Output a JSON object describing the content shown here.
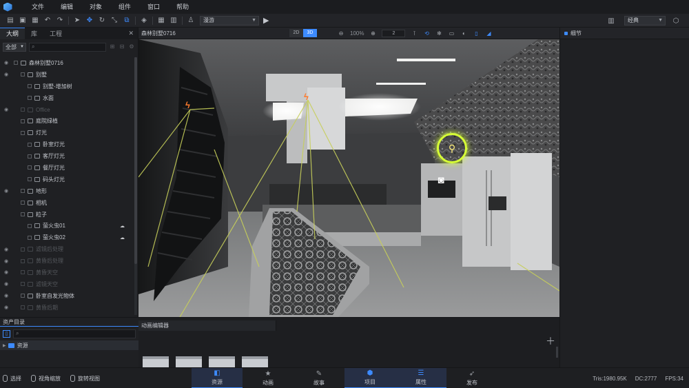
{
  "menu": [
    "文件",
    "编辑",
    "对象",
    "组件",
    "窗口",
    "帮助"
  ],
  "toolbar": {
    "mode_select": "漫游",
    "style_select": "经典"
  },
  "left_panel": {
    "tabs": [
      "大纲",
      "库",
      "工程"
    ],
    "filter_select": "全部",
    "tree": [
      {
        "label": "森林别墅0716",
        "indent": 0,
        "dim": false,
        "eye": true
      },
      {
        "label": "别墅",
        "indent": 1,
        "dim": false,
        "eye": true
      },
      {
        "label": "别墅-增加树",
        "indent": 2,
        "dim": false,
        "eye": false
      },
      {
        "label": "水面",
        "indent": 2,
        "dim": false,
        "eye": false
      },
      {
        "label": "Office",
        "indent": 1,
        "dim": true,
        "eye": true
      },
      {
        "label": "庭院绿植",
        "indent": 1,
        "dim": false,
        "eye": false
      },
      {
        "label": "灯光",
        "indent": 1,
        "dim": false,
        "eye": false
      },
      {
        "label": "卧室灯光",
        "indent": 2,
        "dim": false,
        "eye": false
      },
      {
        "label": "客厅灯光",
        "indent": 2,
        "dim": false,
        "eye": false
      },
      {
        "label": "餐厅灯光",
        "indent": 2,
        "dim": false,
        "eye": false
      },
      {
        "label": "码头灯光",
        "indent": 2,
        "dim": false,
        "eye": false
      },
      {
        "label": "地形",
        "indent": 1,
        "dim": false,
        "eye": true
      },
      {
        "label": "相机",
        "indent": 1,
        "dim": false,
        "eye": false
      },
      {
        "label": "粒子",
        "indent": 1,
        "dim": false,
        "eye": false
      },
      {
        "label": "萤火虫01",
        "indent": 2,
        "dim": false,
        "eye": false,
        "fire": true
      },
      {
        "label": "萤火虫02",
        "indent": 2,
        "dim": false,
        "eye": false,
        "fire": true
      },
      {
        "label": "滤镜后处理",
        "indent": 1,
        "dim": true,
        "eye": true
      },
      {
        "label": "黄昏后处理",
        "indent": 1,
        "dim": true,
        "eye": true
      },
      {
        "label": "黄昏天空",
        "indent": 1,
        "dim": true,
        "eye": true
      },
      {
        "label": "滤镜天空",
        "indent": 1,
        "dim": true,
        "eye": true
      },
      {
        "label": "卧室自发光物体",
        "indent": 1,
        "dim": false,
        "eye": true
      },
      {
        "label": "黄昏后期",
        "indent": 1,
        "dim": true,
        "eye": true
      }
    ]
  },
  "viewport": {
    "title": "森林别墅0716",
    "mode_2d": "2D",
    "mode_3d": "3D",
    "zoom": "100%",
    "count_field": "2"
  },
  "right_panel": {
    "title": "细节"
  },
  "asset_panel": {
    "title": "资产目录",
    "root_folder": "资源"
  },
  "anim_panel": {
    "title": "动画编辑器"
  },
  "bottom": {
    "hints": [
      "选择",
      "视角缩放",
      "旋转视图"
    ],
    "tabs": [
      {
        "label": "资源",
        "active": true
      },
      {
        "label": "动画",
        "active": false
      },
      {
        "label": "故事",
        "active": false
      },
      {
        "label": "项目",
        "active": true
      },
      {
        "label": "属性",
        "active": true
      },
      {
        "label": "发布",
        "active": false
      }
    ],
    "stats": {
      "tris": "Tris:1980.95K",
      "dc": "DC:2777",
      "fps": "FPS:34"
    }
  },
  "colors": {
    "accent": "#3d8bff",
    "probe": "#d7ff36",
    "light_gizmo": "#ff7b2e"
  }
}
